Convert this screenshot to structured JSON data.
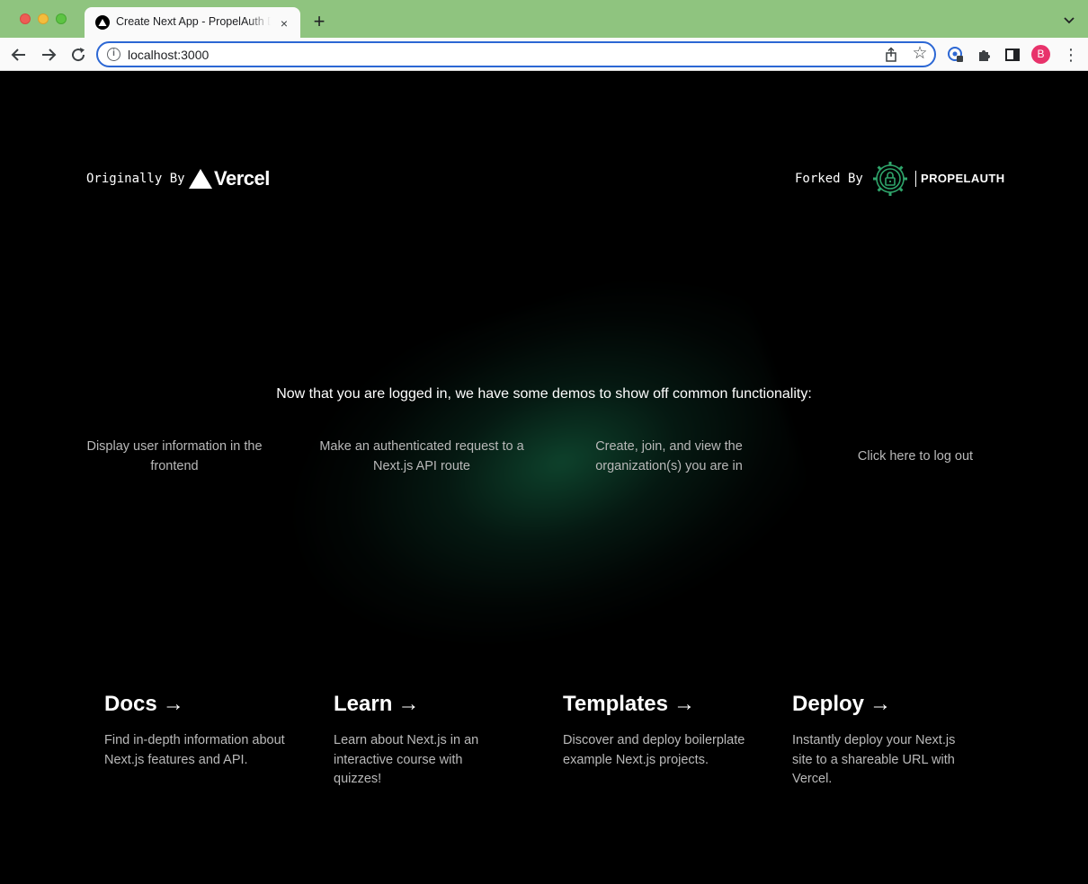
{
  "browser": {
    "tab_title": "Create Next App - PropelAuth Demo",
    "new_tab_symbol": "+",
    "tab_close_symbol": "×",
    "url": "localhost:3000",
    "avatar_initial": "B",
    "info_symbol": "i",
    "star_symbol": "☆",
    "menu_symbol": "⋮",
    "colors": {
      "tabstrip": "#8fc47f",
      "omnibox_focus": "#2c67d4",
      "avatar": "#e8336b"
    }
  },
  "header": {
    "originally_by": "Originally By",
    "vercel_name": "Vercel",
    "forked_by": "Forked By",
    "propelauth_name": "PROPELAUTH"
  },
  "main": {
    "intro": "Now that you are logged in, we have some demos to show off common functionality:",
    "demos": [
      {
        "label": "Display user information in the frontend"
      },
      {
        "label": "Make an authenticated request to a Next.js API route"
      },
      {
        "label": "Create, join, and view the organization(s) you are in"
      },
      {
        "label": "Click here to log out"
      }
    ],
    "glow_color": "#19784f"
  },
  "cards": [
    {
      "title": "Docs",
      "arrow": "→",
      "desc": "Find in-depth information about Next.js features and API."
    },
    {
      "title": "Learn",
      "arrow": "→",
      "desc": "Learn about Next.js in an interactive course with quizzes!"
    },
    {
      "title": "Templates",
      "arrow": "→",
      "desc": "Discover and deploy boilerplate example Next.js projects."
    },
    {
      "title": "Deploy",
      "arrow": "→",
      "desc": "Instantly deploy your Next.js site to a shareable URL with Vercel."
    }
  ]
}
